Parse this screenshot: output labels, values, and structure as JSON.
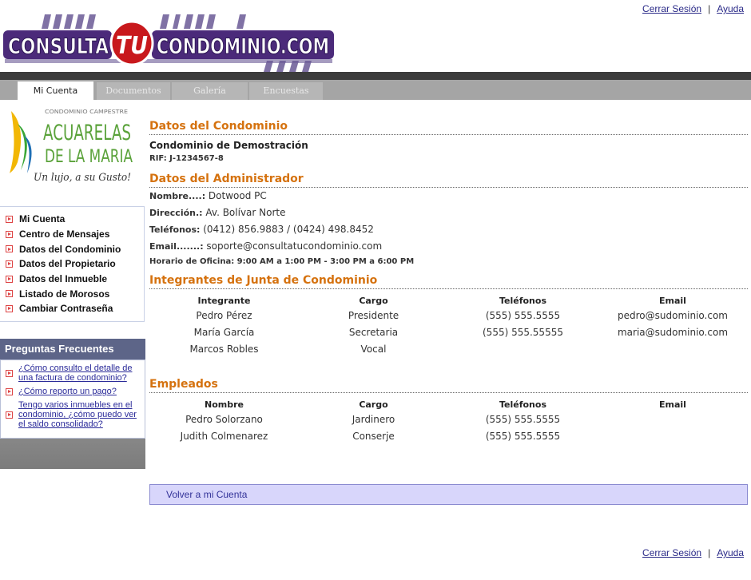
{
  "header": {
    "logout_label": "Cerrar Sesión",
    "help_label": "Ayuda",
    "separator": "|",
    "logo_text_left": "CONSULTA",
    "logo_text_mid": "TU",
    "logo_text_right": "CONDOMINIO.COM"
  },
  "tabs": [
    {
      "label": "Mi Cuenta",
      "active": true
    },
    {
      "label": "Documentos",
      "active": false
    },
    {
      "label": "Galería",
      "active": false
    },
    {
      "label": "Encuestas",
      "active": false
    }
  ],
  "condo_logo": {
    "small": "CONDOMINIO CAMPESTRE",
    "line1": "ACUARELAS",
    "line2": "DE LA MARIA",
    "tagline": "Un lujo, a su Gusto!"
  },
  "menu": [
    "Mi Cuenta",
    "Centro de Mensajes",
    "Datos del Condominio",
    "Datos del Propietario",
    "Datos del Inmueble",
    "Listado de Morosos",
    "Cambiar Contraseña"
  ],
  "faq": {
    "title": "Preguntas Frecuentes",
    "items": [
      "¿Cómo consulto el detalle de una factura de condominio?",
      "¿Cómo reporto un pago?",
      "Tengo varios inmuebles en el condominio, ¿cómo puedo ver el saldo consolidado?"
    ]
  },
  "condominio": {
    "title": "Datos del Condominio",
    "name": "Condominio de Demostración",
    "rif": "RIF: J-1234567-8"
  },
  "administrador": {
    "title": "Datos del Administrador",
    "nombre_label": "Nombre....:",
    "nombre": " Dotwood PC",
    "direccion_label": "Dirección.:",
    "direccion": " Av. Bolívar Norte",
    "telefonos_label": "Teléfonos:",
    "telefonos": " (0412) 856.9883 / (0424) 498.8452",
    "email_label": "Email.......:",
    "email": " soporte@consultatucondominio.com",
    "horario": "Horario de Oficina: 9:00 AM a 1:00 PM - 3:00 PM a 6:00 PM"
  },
  "junta": {
    "title": "Integrantes de Junta de Condominio",
    "headers": [
      "Integrante",
      "Cargo",
      "Teléfonos",
      "Email"
    ],
    "rows": [
      [
        "Pedro Pérez",
        "Presidente",
        "(555) 555.5555",
        "pedro@sudominio.com"
      ],
      [
        "María García",
        "Secretaria",
        "(555) 555.55555",
        "maria@sudominio.com"
      ],
      [
        "Marcos Robles",
        "Vocal",
        "",
        ""
      ]
    ]
  },
  "empleados": {
    "title": "Empleados",
    "headers": [
      "Nombre",
      "Cargo",
      "Teléfonos",
      "Email"
    ],
    "rows": [
      [
        "Pedro Solorzano",
        "Jardinero",
        "(555) 555.5555",
        ""
      ],
      [
        "Judith Colmenarez",
        "Conserje",
        "(555) 555.5555",
        ""
      ]
    ]
  },
  "volver_label": "Volver a mi Cuenta",
  "colors": {
    "section_title": "#d5720f",
    "logo_purple": "#4b2a7a",
    "logo_red": "#c8181c",
    "volver_bg": "#d8d6fb"
  }
}
